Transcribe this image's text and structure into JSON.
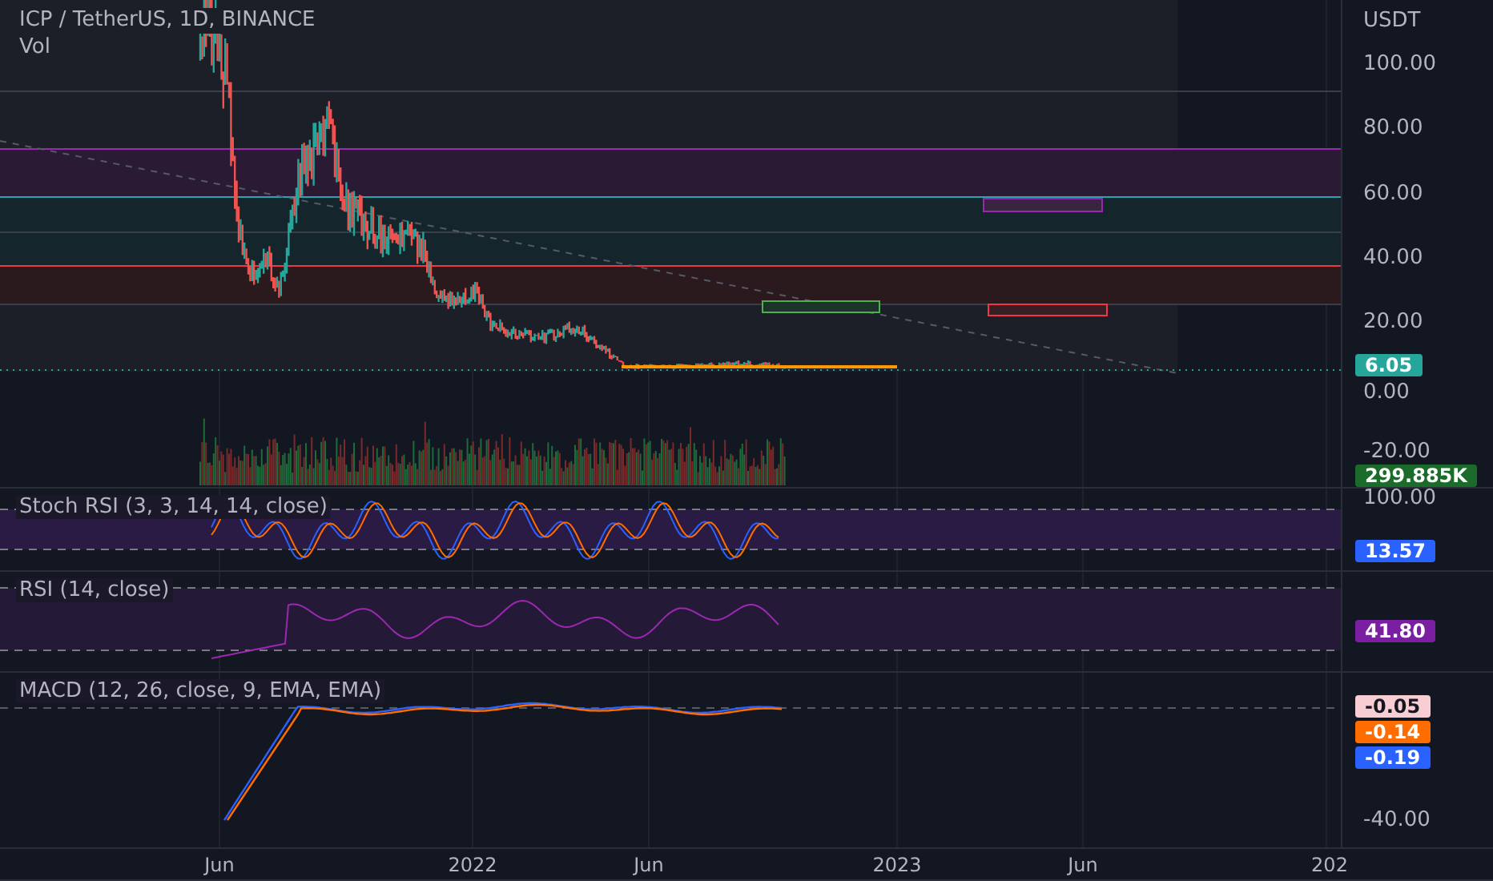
{
  "legend": {
    "symbol": "ICP / TetherUS, 1D, BINANCE",
    "volume": "Vol"
  },
  "price_axis": {
    "unit": "USDT",
    "ticks": [
      "100.00",
      "80.00",
      "60.00",
      "40.00",
      "20.00",
      "0.00",
      "-20.00"
    ],
    "badges": [
      {
        "text": "6.05",
        "color": "#26a69a"
      },
      {
        "text": "299.885K",
        "color": "#1b6b2a"
      }
    ]
  },
  "panes": [
    {
      "kind": "stoch",
      "title": "Stoch RSI (3, 3, 14, 14, close)",
      "ticks": [
        "100.00"
      ],
      "badges": [
        {
          "text": "13.57",
          "color": "#2962ff"
        }
      ]
    },
    {
      "kind": "rsi",
      "title": "RSI (14, close)",
      "badges": [
        {
          "text": "41.80",
          "color": "#7b1fa2"
        }
      ]
    },
    {
      "kind": "macd",
      "title": "MACD (12, 26, close, 9, EMA, EMA)",
      "ticks": [
        "-40.00"
      ],
      "badges": [
        {
          "text": "-0.05",
          "color": "#f8cdd3"
        },
        {
          "text": "-0.14",
          "color": "#ff6d00"
        },
        {
          "text": "-0.19",
          "color": "#2962ff"
        }
      ]
    }
  ],
  "time_axis": [
    "Jun",
    "2022",
    "Jun",
    "2023",
    "Jun",
    "202"
  ]
}
